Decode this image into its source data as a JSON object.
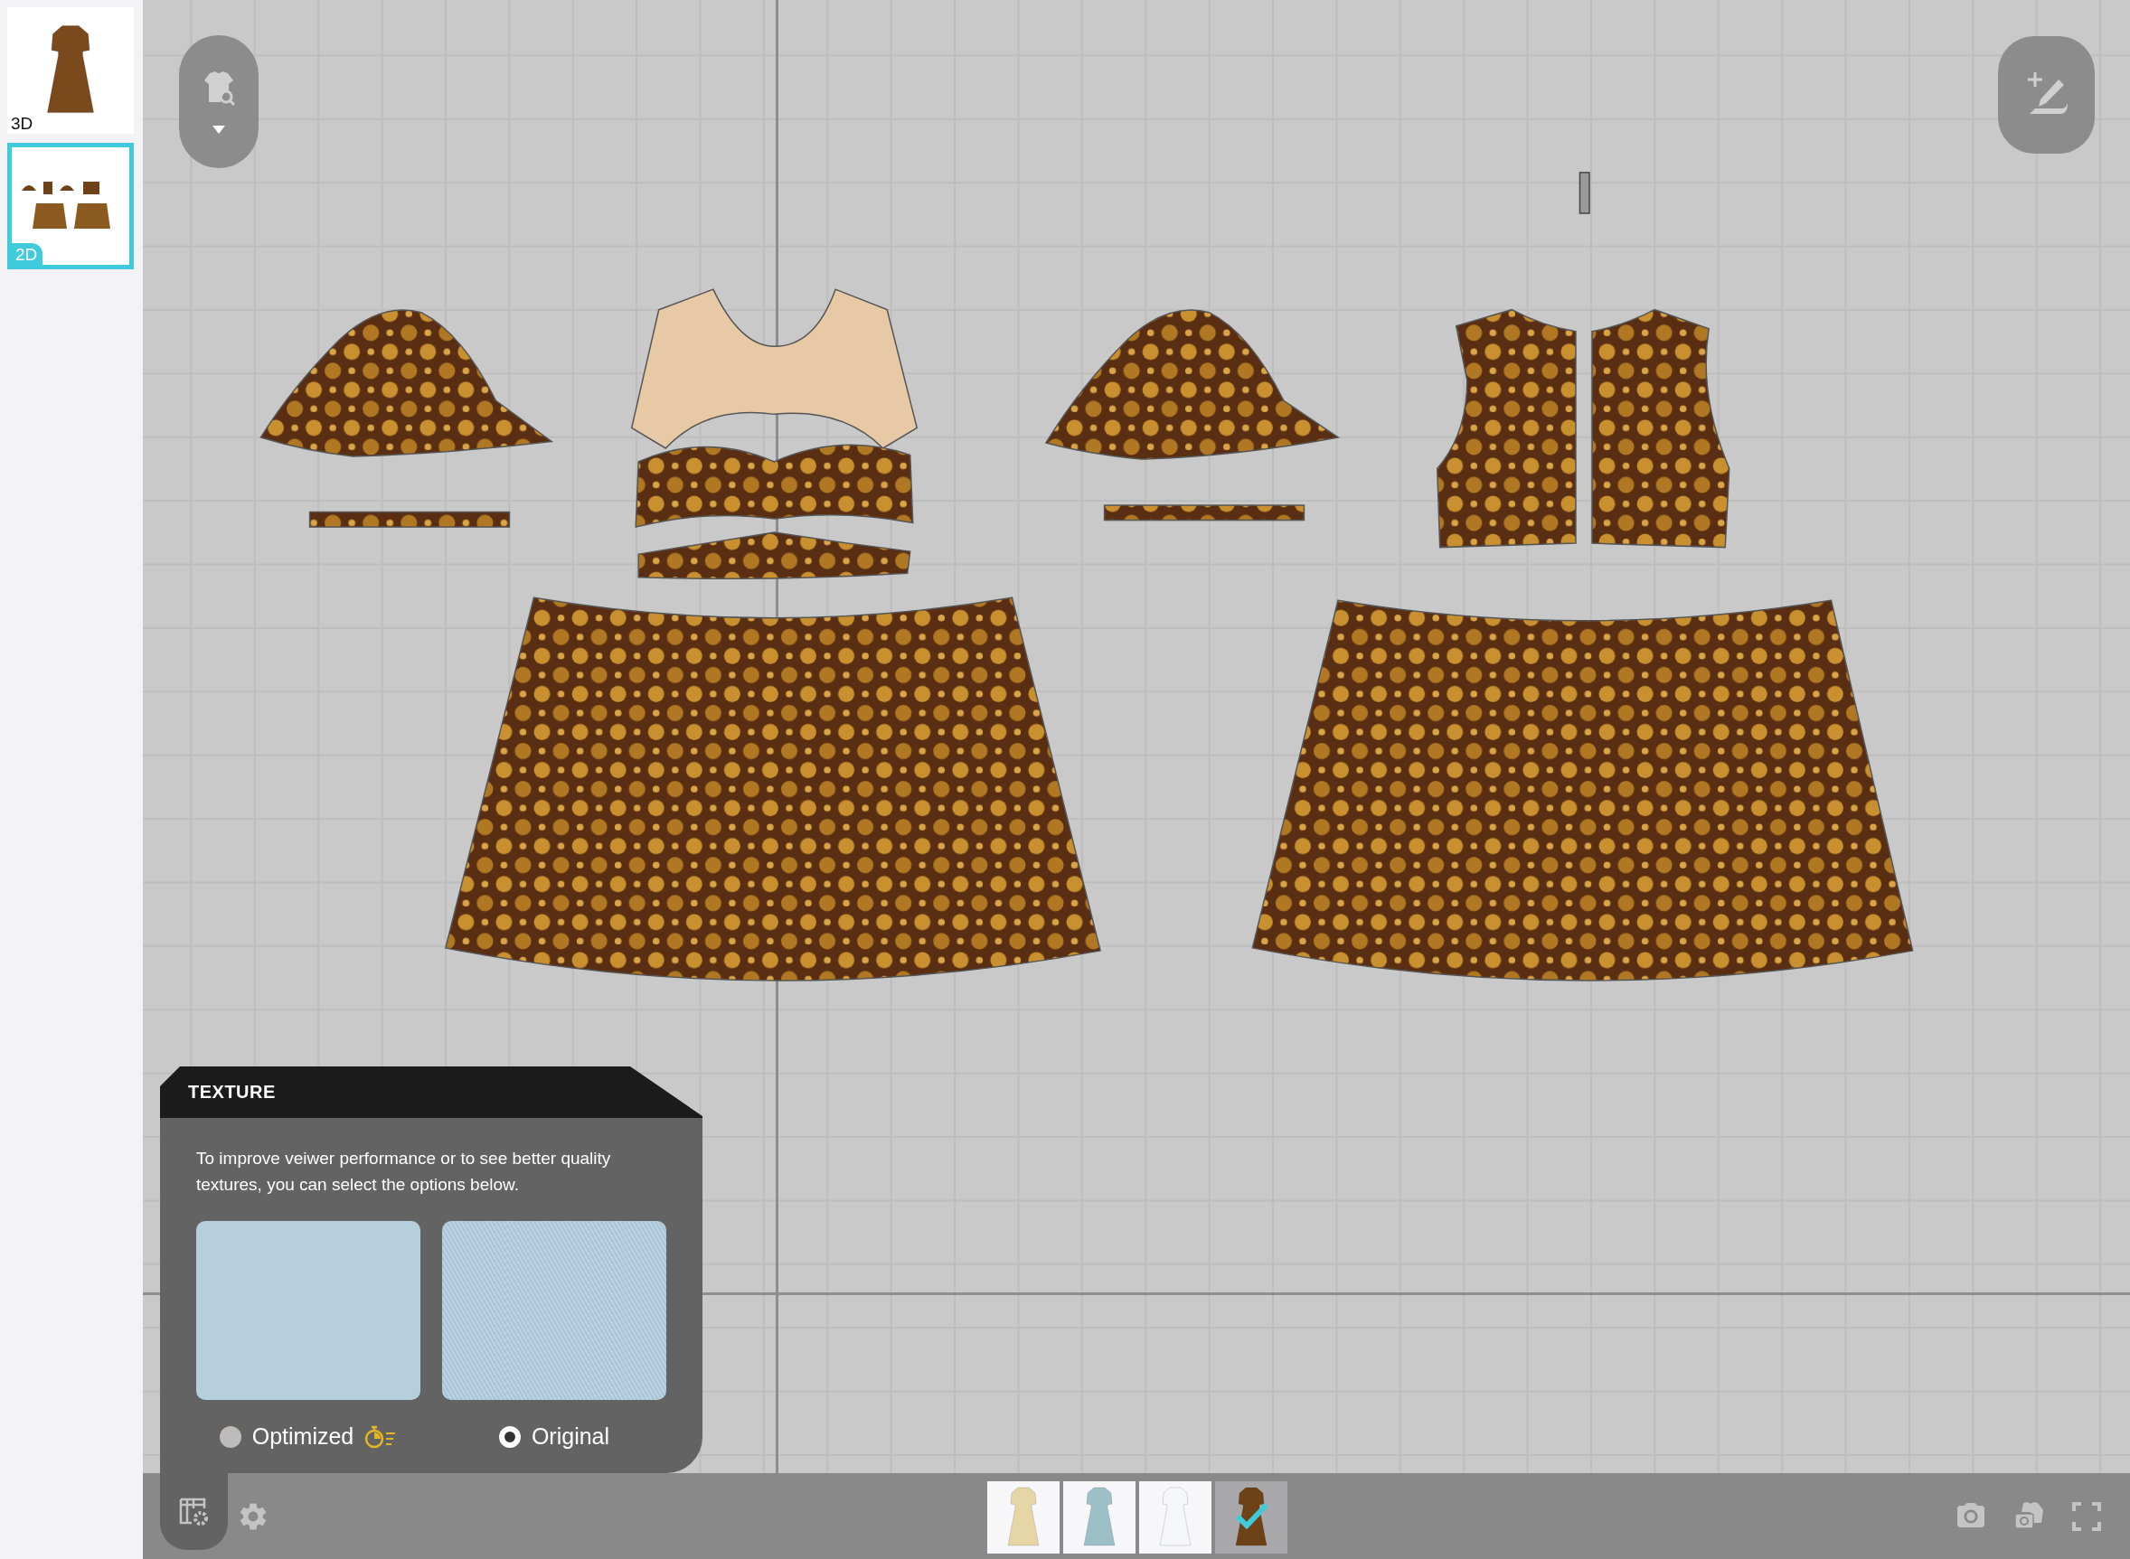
{
  "sidebar": {
    "views": [
      {
        "label": "3D",
        "selected": false
      },
      {
        "label": "2D",
        "selected": true
      }
    ]
  },
  "texture_panel": {
    "title": "TEXTURE",
    "description": "To improve veiwer performance or to see better quality textures, you can select the options below.",
    "options": [
      {
        "label": "Optimized",
        "selected": false,
        "kind": "fast"
      },
      {
        "label": "Original",
        "selected": true,
        "kind": "plain"
      }
    ]
  },
  "colorways": [
    {
      "color": "#e6d6a6",
      "selected": false
    },
    {
      "color": "#9dbfc6",
      "selected": false
    },
    {
      "color": "#f4f6f8",
      "selected": false
    },
    {
      "color": "#6e4218",
      "selected": true
    }
  ]
}
